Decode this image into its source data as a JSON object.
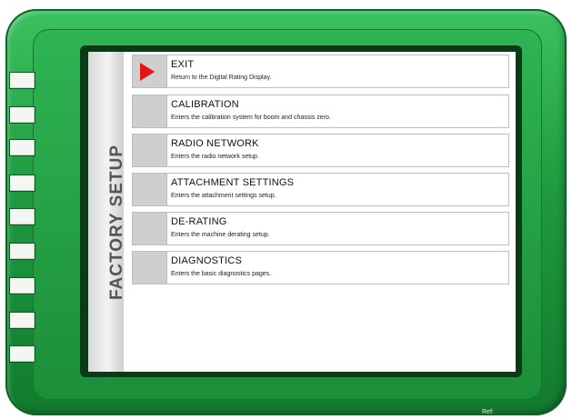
{
  "sidebar": {
    "title": "FACTORY SETUP"
  },
  "menu": [
    {
      "label": "EXIT",
      "desc": "Return to the Digital Rating Display.",
      "selected": true
    },
    {
      "label": "CALIBRATION",
      "desc": "Enters the calibration system for boom and chassis zero.",
      "selected": false
    },
    {
      "label": "RADIO NETWORK",
      "desc": "Enters the radio network setup.",
      "selected": false
    },
    {
      "label": "ATTACHMENT SETTINGS",
      "desc": "Enters the attachment settings setup.",
      "selected": false
    },
    {
      "label": "DE-RATING",
      "desc": "Enters the machine derating setup.",
      "selected": false
    },
    {
      "label": "DIAGNOSTICS",
      "desc": "Enters the basic diagnostics pages.",
      "selected": false
    }
  ],
  "footer": {
    "ref": "Ref:"
  },
  "colors": {
    "bezel": "#1f9a3f",
    "selection_arrow": "#e01414"
  }
}
